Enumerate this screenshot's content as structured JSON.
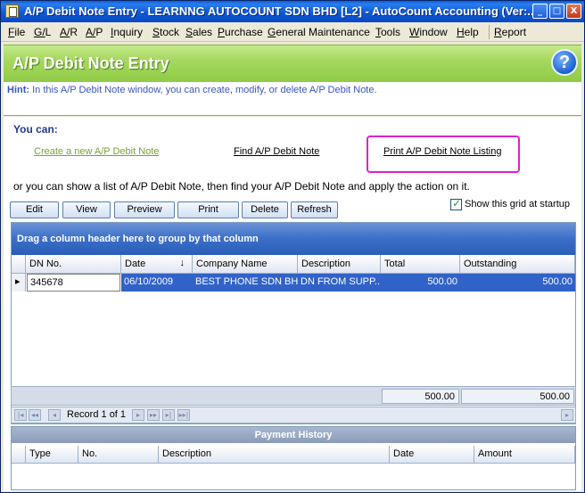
{
  "window": {
    "title": "A/P Debit Note Entry - LEARNNG AUTOCOUNT SDN BHD [L2] - AutoCount Accounting (Ver:...",
    "minimize_glyph": "_",
    "maximize_glyph": "□",
    "close_glyph": "X"
  },
  "menu": [
    "File",
    "G/L",
    "A/R",
    "A/P",
    "Inquiry",
    "Stock",
    "Sales",
    "Purchase",
    "General Maintenance",
    "Tools",
    "Window",
    "Help",
    "Report"
  ],
  "banner": {
    "title": "A/P Debit Note Entry",
    "help_glyph": "?"
  },
  "hint": {
    "label": "Hint:",
    "text": " In this A/P Debit Note window, you can create, modify, or delete A/P Debit Note."
  },
  "actions": {
    "you_can": "You can:",
    "create": "Create a new A/P Debit Note",
    "find": "Find A/P Debit Note",
    "print": "Print A/P Debit Note Listing",
    "or_line": "or you can show a list of A/P Debit Note, then find your A/P Debit Note and apply the action on it."
  },
  "toolbar": {
    "edit": "Edit",
    "view": "View",
    "preview": "Preview",
    "print": "Print",
    "delete": "Delete",
    "refresh": "Refresh",
    "show_grid": "Show this grid at startup"
  },
  "grid": {
    "group_hint": "Drag a column header here to group by that column",
    "columns": [
      "DN No.",
      "Date",
      "Company Name",
      "Description",
      "Total",
      "Outstanding"
    ],
    "rows": [
      {
        "dn_no": "345678",
        "date": "06/10/2009",
        "company": "BEST PHONE SDN BHD",
        "description": "DN FROM SUPP...",
        "total": "500.00",
        "outstanding": "500.00"
      }
    ],
    "footer_total": "500.00",
    "footer_outstanding": "500.00",
    "record_text": "Record 1 of 1"
  },
  "payment_history": {
    "title": "Payment History",
    "columns": [
      "Type",
      "No.",
      "Description",
      "Date",
      "Amount"
    ]
  }
}
